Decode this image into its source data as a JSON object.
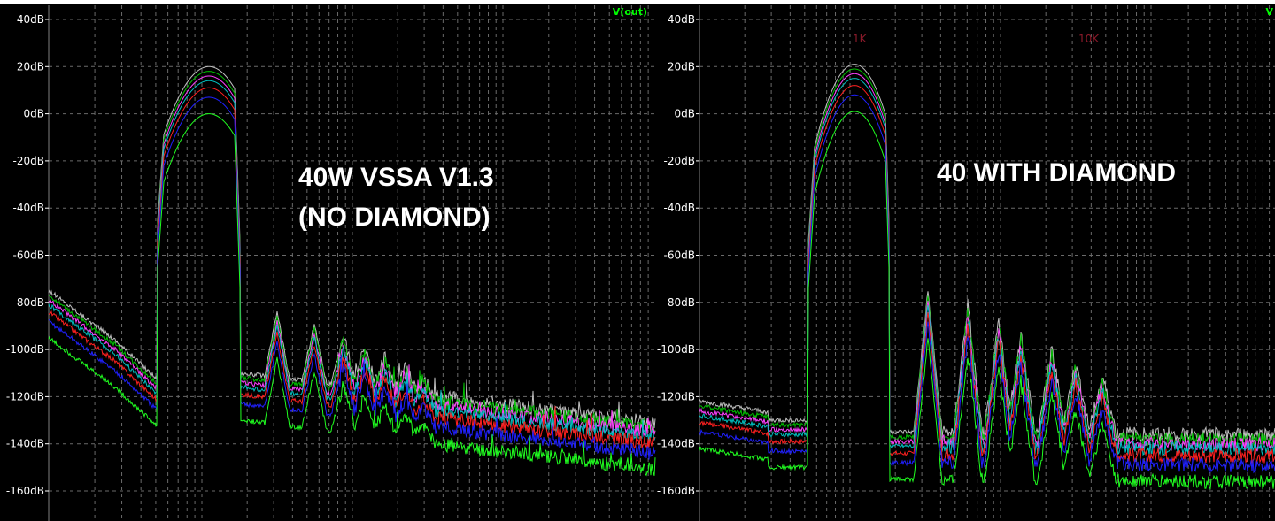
{
  "chart_data": [
    {
      "type": "line",
      "trace_label": "V(out)",
      "y_unit": "dB",
      "ylim": [
        -170,
        40
      ],
      "yticks": [
        "40dB",
        "20dB",
        "0dB",
        "-20dB",
        "-40dB",
        "-60dB",
        "-80dB",
        "-100dB",
        "-120dB",
        "-140dB",
        "-160dB"
      ],
      "ytick_values": [
        40,
        20,
        0,
        -20,
        -40,
        -60,
        -80,
        -100,
        -120,
        -140,
        -160
      ],
      "x_scale": "log",
      "grid": true,
      "annotations": [
        "40W VSSA V1.3",
        "(NO DIAMOND)"
      ],
      "series_colors": [
        "#c0c0c0",
        "#00c000",
        "#ff40ff",
        "#00c0c0",
        "#ff2020",
        "#2020ff",
        "#20ff20"
      ],
      "series_offsets_db": [
        0,
        2,
        4,
        6,
        9,
        13,
        20
      ]
    },
    {
      "type": "line",
      "trace_label": "V",
      "y_unit": "dB",
      "ylim": [
        -170,
        40
      ],
      "yticks": [
        "40dB",
        "20dB",
        "0dB",
        "-20dB",
        "-40dB",
        "-60dB",
        "-80dB",
        "-100dB",
        "-120dB",
        "-140dB",
        "-160dB"
      ],
      "ytick_values": [
        40,
        20,
        0,
        -20,
        -40,
        -60,
        -80,
        -100,
        -120,
        -140,
        -160
      ],
      "x_scale": "log",
      "grid": true,
      "cursors": [
        "1K",
        "10K"
      ],
      "annotations": [
        "40 WITH DIAMOND"
      ],
      "series_colors": [
        "#c0c0c0",
        "#00c000",
        "#ff40ff",
        "#00c0c0",
        "#ff2020",
        "#2020ff",
        "#20ff20"
      ],
      "series_offsets_db": [
        0,
        2,
        4,
        6,
        9,
        13,
        20
      ]
    }
  ]
}
